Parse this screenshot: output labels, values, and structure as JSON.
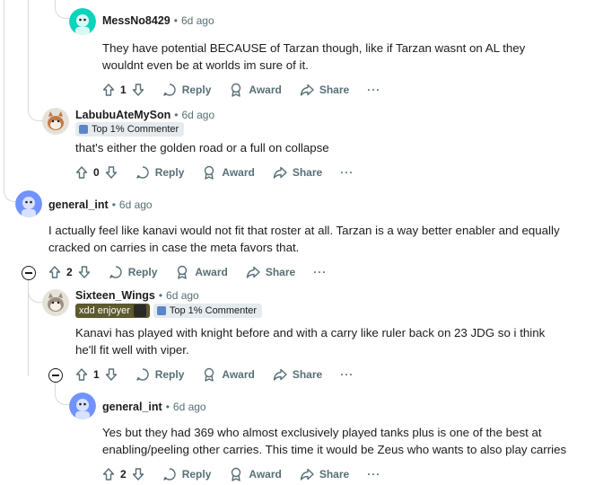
{
  "comments": [
    {
      "username": "MessNo8429",
      "age": "6d ago",
      "text": "They have potential BECAUSE of Tarzan though, like if Tarzan wasnt on AL they wouldnt even be at worlds im sure of it.",
      "votes": "1"
    },
    {
      "username": "LabubuAteMySon",
      "age": "6d ago",
      "flair": "Top 1% Commenter",
      "text": "that's either the golden road or a full on collapse",
      "votes": "0"
    },
    {
      "username": "general_int",
      "age": "6d ago",
      "text": "I actually feel like kanavi would not fit that roster at all. Tarzan is a way better enabler and equally cracked on carries in case the meta favors that.",
      "votes": "2"
    },
    {
      "username": "Sixteen_Wings",
      "age": "6d ago",
      "user_flair": "xdd enjoyer",
      "flair": "Top 1% Commenter",
      "text": "Kanavi has played with knight before and with a carry like ruler back on 23 JDG so i think he'll fit well with viper.",
      "votes": "1"
    },
    {
      "username": "general_int",
      "age": "6d ago",
      "text": "Yes but they had 369 who almost exclusively played tanks plus is one of the best at enabling/peeling other carries. This time it would be Zeus who wants to also play carries",
      "votes": "2"
    }
  ],
  "actions": {
    "reply": "Reply",
    "award": "Award",
    "share": "Share",
    "more": "···"
  },
  "separator": "•",
  "colors": {
    "meta_gray": "#576f76",
    "thread_line": "#d6dadc",
    "flair_bg": "#e5ebee",
    "avatar_blue": "#7193ff"
  }
}
